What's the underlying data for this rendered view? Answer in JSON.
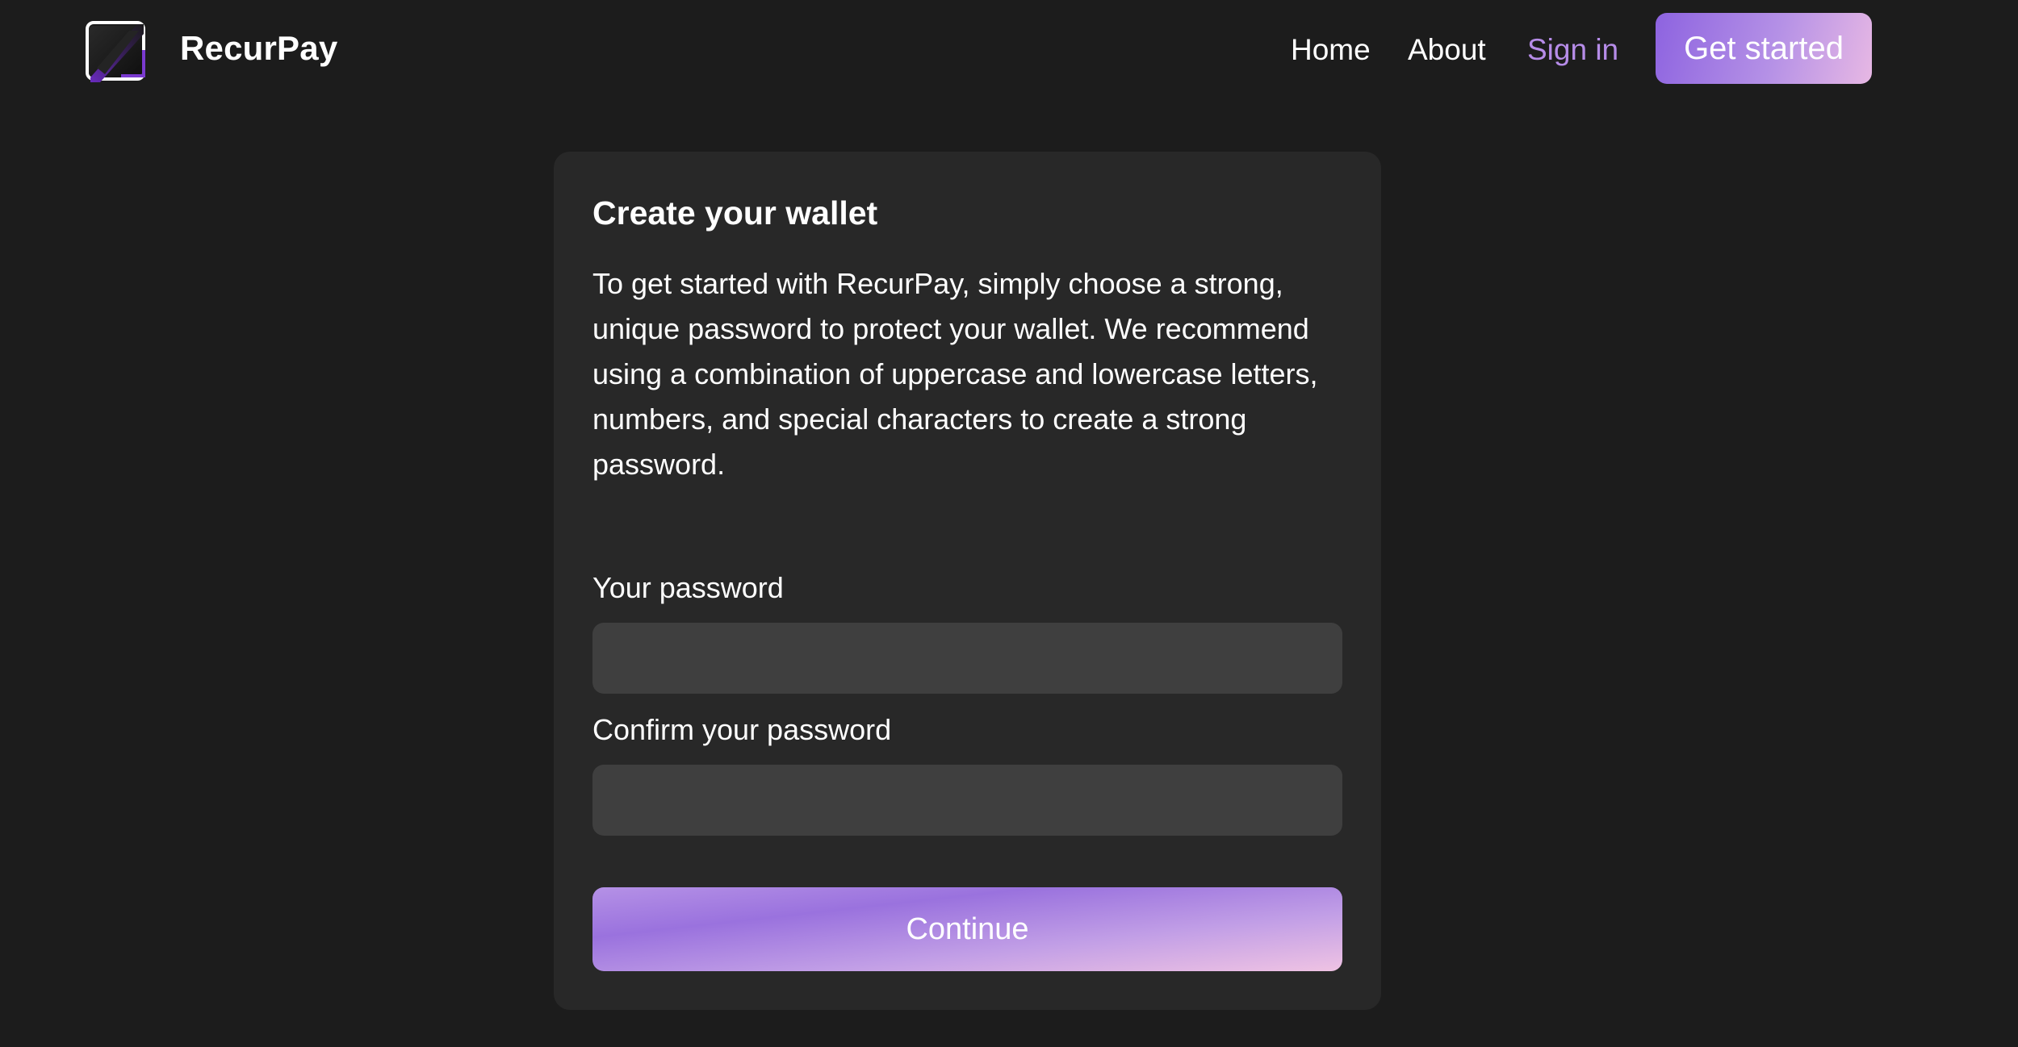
{
  "header": {
    "brand": "RecurPay",
    "logo_icon": "wallet-logo-icon",
    "nav": {
      "home": "Home",
      "about": "About",
      "sign_in": "Sign in"
    },
    "cta_label": "Get started"
  },
  "card": {
    "title": "Create your wallet",
    "description": "To get started with RecurPay, simply choose a strong, unique password to protect your wallet. We recommend using a combination of uppercase and lowercase letters, numbers, and special characters to create a strong password.",
    "password_label": "Your password",
    "password_value": "",
    "confirm_label": "Confirm your password",
    "confirm_value": "",
    "continue_label": "Continue"
  },
  "colors": {
    "background": "#1c1c1c",
    "card": "#282828",
    "input": "#3f3f3f",
    "accent": "#b68ce8",
    "gradient_start": "#8d63e0",
    "gradient_end": "#efc3e3"
  }
}
